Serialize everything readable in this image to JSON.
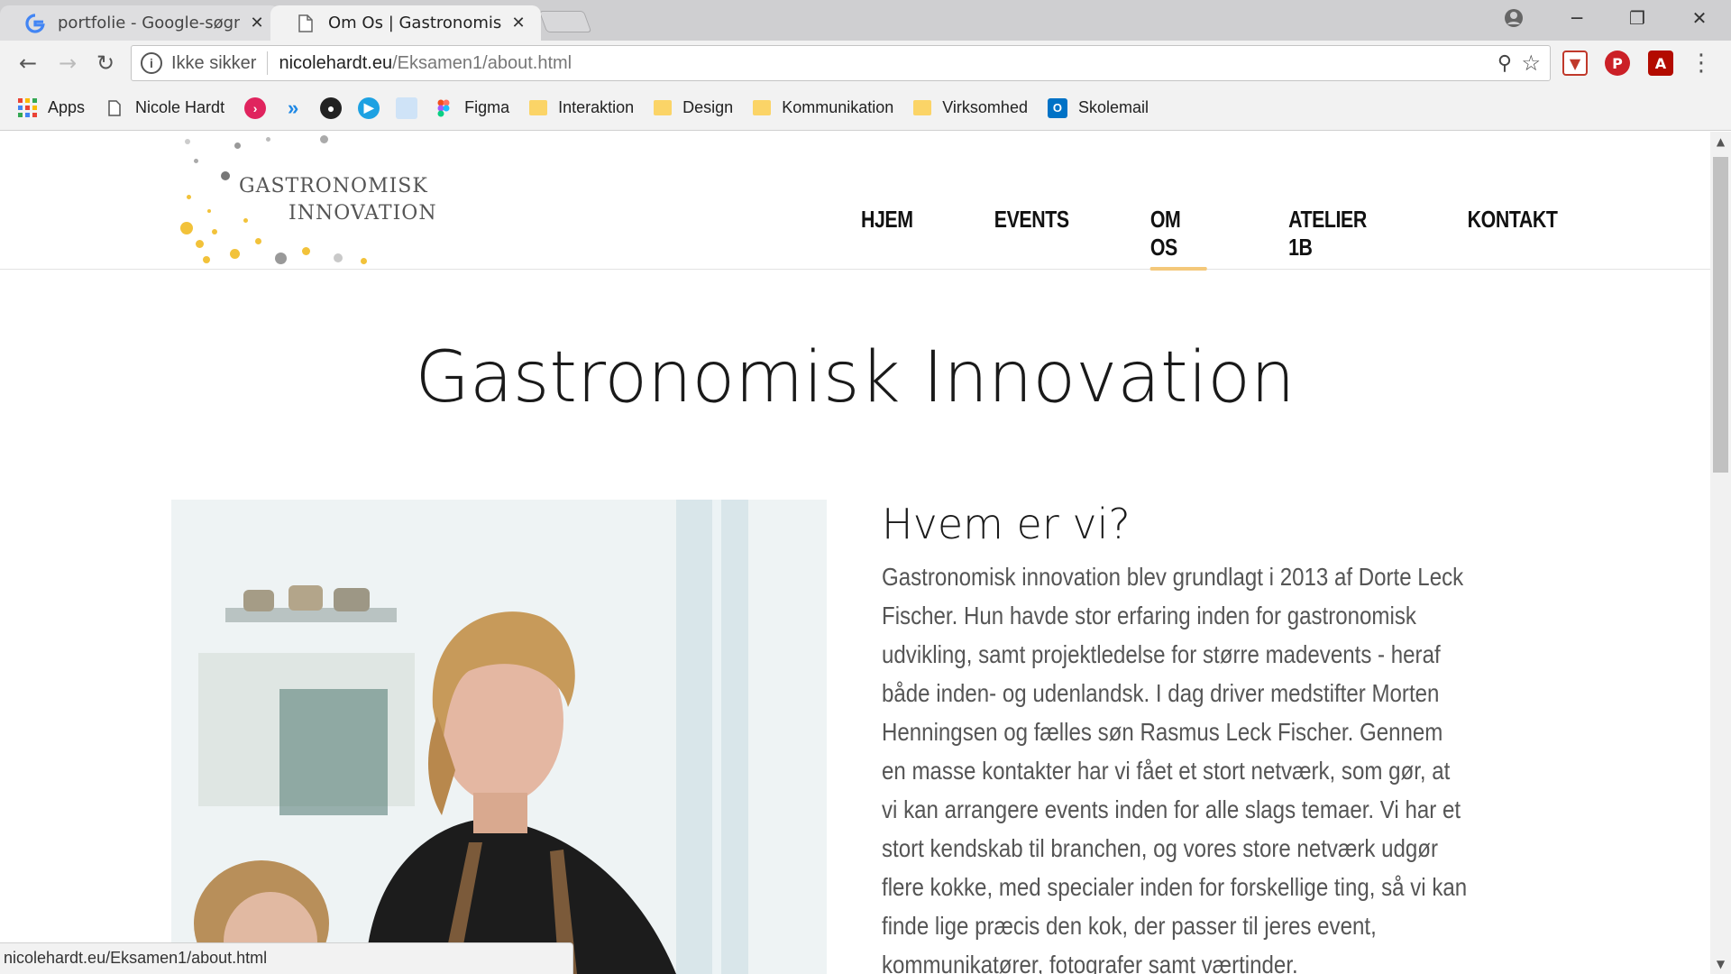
{
  "browser": {
    "tabs": [
      {
        "title": "portfolie - Google-søgnin",
        "favicon": "google-icon"
      },
      {
        "title": "Om Os | Gastronomisk Inno",
        "favicon": "page-icon",
        "active": true
      }
    ],
    "address": {
      "security_label": "Ikke sikker",
      "domain": "nicolehardt.eu",
      "path": "/Eksamen1/about.html"
    },
    "bookmarks": {
      "apps_label": "Apps",
      "nicole_label": "Nicole Hardt",
      "figma_label": "Figma",
      "folders": [
        "Interaktion",
        "Design",
        "Kommunikation",
        "Virksomhed"
      ],
      "skolemail_label": "Skolemail"
    },
    "status_url": "nicolehardt.eu/Eksamen1/about.html"
  },
  "site": {
    "logo": {
      "line1": "GASTRONOMISK",
      "line2": "INNOVATION"
    },
    "nav": [
      "HJEM",
      "EVENTS",
      "OM OS",
      "ATELIER 1B",
      "KONTAKT"
    ],
    "active_nav": "OM OS",
    "hero_title": "Gastronomisk Innovation",
    "section_title": "Hvem er vi?",
    "section_text": "Gastronomisk innovation blev grundlagt i 2013 af Dorte Leck Fischer. Hun havde stor erfaring inden for gastronomisk udvikling, samt projektledelse for større madevents - heraf både inden- og udenlandsk. I dag driver medstifter Morten Henningsen og fælles søn Rasmus Leck Fischer. Gennem en masse kontakter har vi fået et stort netværk, som gør, at vi kan arrangere events inden for alle slags temaer. Vi har et stort kendskab til branchen, og vores store netværk udgør flere kokke, med specialer inden for forskellige ting, så vi kan finde lige præcis den kok, der passer til jeres event, kommunikatører, fotografer samt værtinder."
  },
  "colors": {
    "accent_underline": "#f4c87a",
    "logo_gold": "#f2c23a",
    "text_body": "#555555"
  }
}
